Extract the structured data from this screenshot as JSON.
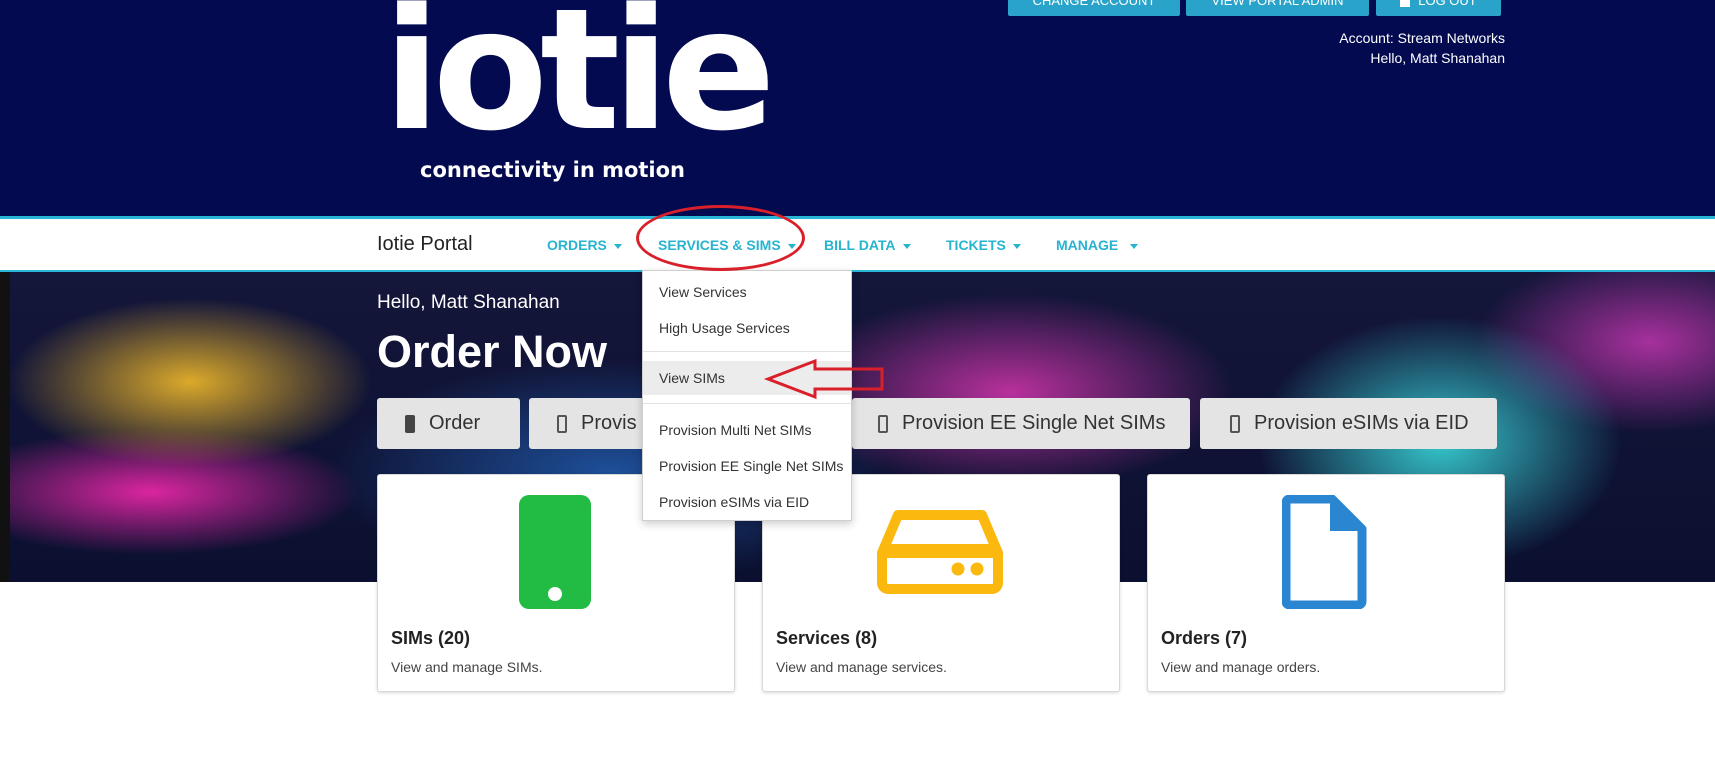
{
  "header": {
    "logo_text": "iotie",
    "logo_tagline": "connectivity in motion",
    "buttons": [
      {
        "label": "CHANGE ACCOUNT"
      },
      {
        "label": "VIEW PORTAL ADMIN"
      },
      {
        "label": "LOG OUT"
      }
    ],
    "account_line": "Account: Stream Networks",
    "greeting_line": "Hello, Matt Shanahan"
  },
  "navbar": {
    "brand": "Iotie Portal",
    "items": [
      {
        "label": "ORDERS"
      },
      {
        "label": "SERVICES & SIMS"
      },
      {
        "label": "BILL DATA"
      },
      {
        "label": "TICKETS"
      },
      {
        "label": "MANAGE"
      }
    ]
  },
  "dropdown": {
    "items": [
      {
        "label": "View Services"
      },
      {
        "label": "High Usage Services"
      },
      {
        "label": "View SIMs"
      },
      {
        "label": "Provision Multi Net SIMs"
      },
      {
        "label": "Provision EE Single Net SIMs"
      },
      {
        "label": "Provision eSIMs via EID"
      }
    ]
  },
  "hero": {
    "greeting": "Hello, Matt Shanahan",
    "title": "Order Now",
    "quick_buttons": [
      {
        "label": "Order"
      },
      {
        "label": "Provis"
      },
      {
        "label": "Provision EE Single Net SIMs"
      },
      {
        "label": "Provision eSIMs via EID"
      }
    ]
  },
  "cards": [
    {
      "title": "SIMs (20)",
      "description": "View and manage SIMs.",
      "icon": "phone-icon",
      "color": "#22bb44"
    },
    {
      "title": "Services (8)",
      "description": "View and manage services.",
      "icon": "server-icon",
      "color": "#fbb80f"
    },
    {
      "title": "Orders (7)",
      "description": "View and manage orders.",
      "icon": "document-icon",
      "color": "#2b86d1"
    }
  ],
  "colors": {
    "header_bg": "#030a50",
    "accent": "#29b7d8",
    "annotation": "#d9202a"
  }
}
